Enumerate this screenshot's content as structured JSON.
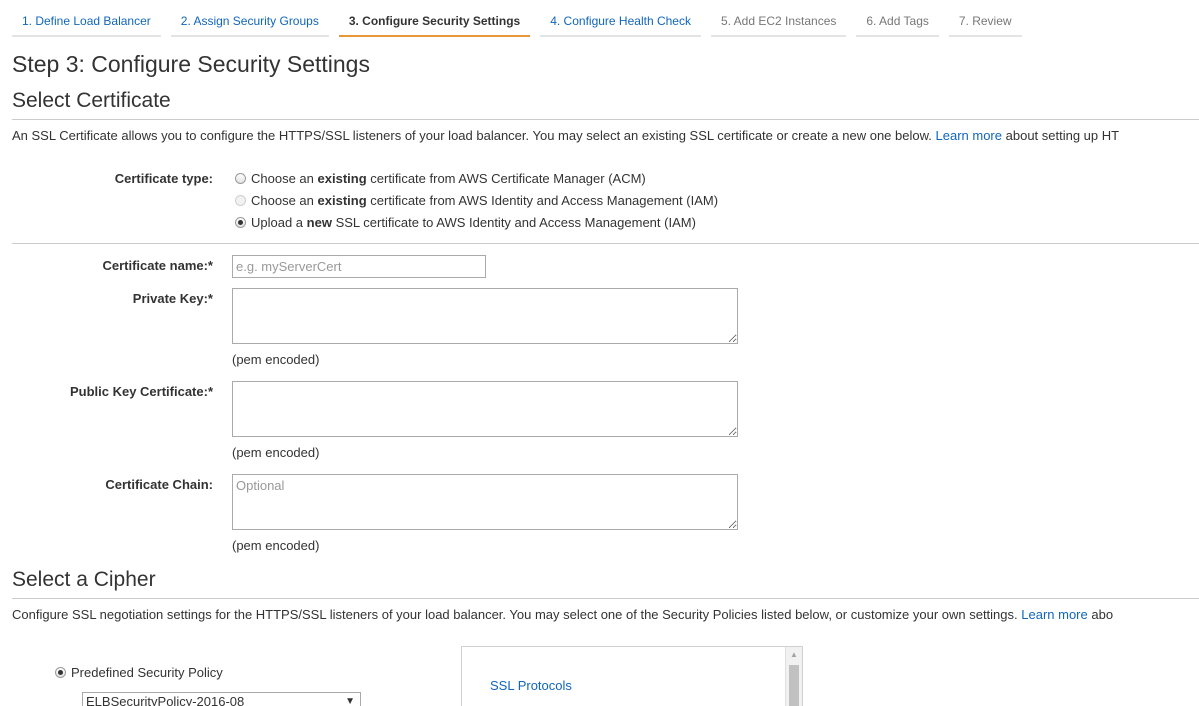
{
  "wizard": {
    "steps": [
      {
        "label": "1. Define Load Balancer",
        "state": "done"
      },
      {
        "label": "2. Assign Security Groups",
        "state": "done"
      },
      {
        "label": "3. Configure Security Settings",
        "state": "active"
      },
      {
        "label": "4. Configure Health Check",
        "state": "next"
      },
      {
        "label": "5. Add EC2 Instances",
        "state": "future"
      },
      {
        "label": "6. Add Tags",
        "state": "future"
      },
      {
        "label": "7. Review",
        "state": "future"
      }
    ]
  },
  "page_title": "Step 3: Configure Security Settings",
  "certificate_section": {
    "title": "Select Certificate",
    "description_pre": "An SSL Certificate allows you to configure the HTTPS/SSL listeners of your load balancer. You may select an existing SSL certificate or create a new one below.",
    "learn_more": "Learn more",
    "description_post": "about setting up HT",
    "type_label": "Certificate type:",
    "options": [
      {
        "pre": "Choose an",
        "bold": "existing",
        "post": "certificate from AWS Certificate Manager (ACM)",
        "checked": false,
        "disabled": false
      },
      {
        "pre": "Choose an",
        "bold": "existing",
        "post": "certificate from AWS Identity and Access Management (IAM)",
        "checked": false,
        "disabled": true
      },
      {
        "pre": "Upload a",
        "bold": "new",
        "post": "SSL certificate to AWS Identity and Access Management (IAM)",
        "checked": true,
        "disabled": false
      }
    ],
    "name_label": "Certificate name:*",
    "name_placeholder": "e.g. myServerCert",
    "private_key_label": "Private Key:*",
    "private_key_hint": "(pem encoded)",
    "public_cert_label": "Public Key Certificate:*",
    "public_cert_hint": "(pem encoded)",
    "chain_label": "Certificate Chain:",
    "chain_placeholder": "Optional",
    "chain_hint": "(pem encoded)"
  },
  "cipher_section": {
    "title": "Select a Cipher",
    "description_pre": "Configure SSL negotiation settings for the HTTPS/SSL listeners of your load balancer. You may select one of the Security Policies listed below, or customize your own settings.",
    "learn_more": "Learn more",
    "description_post": "abo",
    "policy_label": "Predefined Security Policy",
    "policy_selected": "ELBSecurityPolicy-2016-08",
    "protocols_title": "SSL Protocols"
  }
}
